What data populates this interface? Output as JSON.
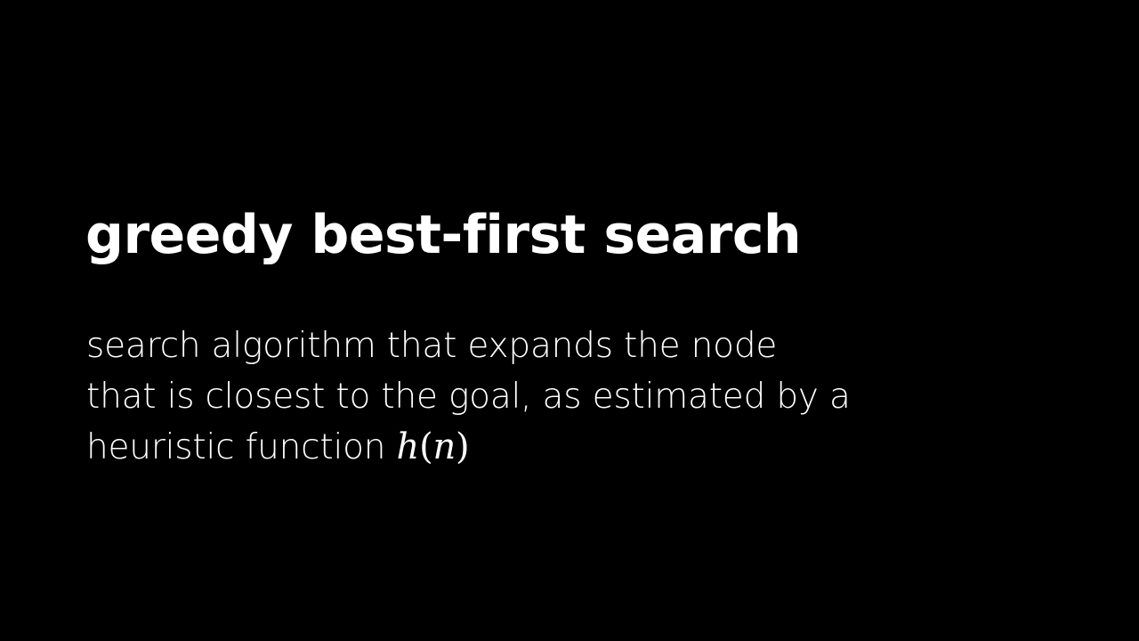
{
  "slide": {
    "title": "greedy best-first search",
    "definition": {
      "line1": "search algorithm that expands the node",
      "line2": "that is closest to the goal, as estimated by a",
      "line3": "heuristic function",
      "formula": {
        "func": "h",
        "open_paren": "(",
        "arg": "n",
        "close_paren": ")"
      }
    },
    "colors": {
      "background": "#000000",
      "text": "#ffffff"
    }
  }
}
